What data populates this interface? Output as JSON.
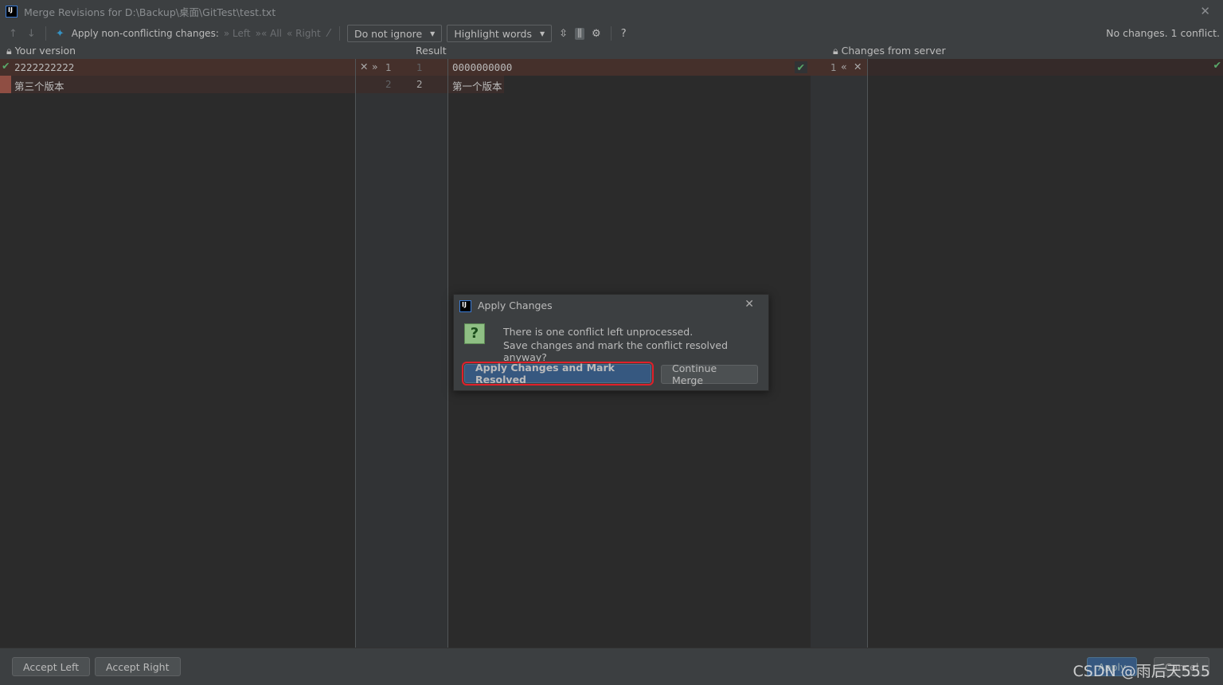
{
  "window": {
    "title": "Merge Revisions for D:\\Backup\\桌面\\GitTest\\test.txt",
    "logo": "IJ"
  },
  "toolbar": {
    "apply_label": "Apply non-conflicting changes:",
    "left": "Left",
    "all": "All",
    "right": "Right",
    "ignore_select": "Do not ignore",
    "highlight_select": "Highlight words",
    "help": "?",
    "status": "No changes. 1 conflict."
  },
  "panes": {
    "left_title": "Your version",
    "center_title": "Result",
    "right_title": "Changes from server"
  },
  "left": {
    "lines": [
      "2222222222",
      "第三个版本"
    ]
  },
  "gutter_left": {
    "left_nums": [
      "1",
      "2"
    ],
    "right_nums": [
      "1",
      "2"
    ]
  },
  "result": {
    "lines": [
      "0000000000",
      "第一个版本"
    ]
  },
  "gutter_right": {
    "nums": [
      "1"
    ]
  },
  "bottom": {
    "accept_left": "Accept Left",
    "accept_right": "Accept Right",
    "apply": "Apply",
    "cancel": "Cancel"
  },
  "dialog": {
    "title": "Apply Changes",
    "logo": "IJ",
    "line1": "There is one conflict left unprocessed.",
    "line2": "Save changes and mark the conflict resolved anyway?",
    "primary": "Apply Changes and Mark Resolved",
    "secondary": "Continue Merge"
  },
  "watermark": "CSDN @雨后天555",
  "colors": {
    "conflict": "#45302b",
    "accent": "#365880",
    "highlight_border": "#e0202a"
  }
}
